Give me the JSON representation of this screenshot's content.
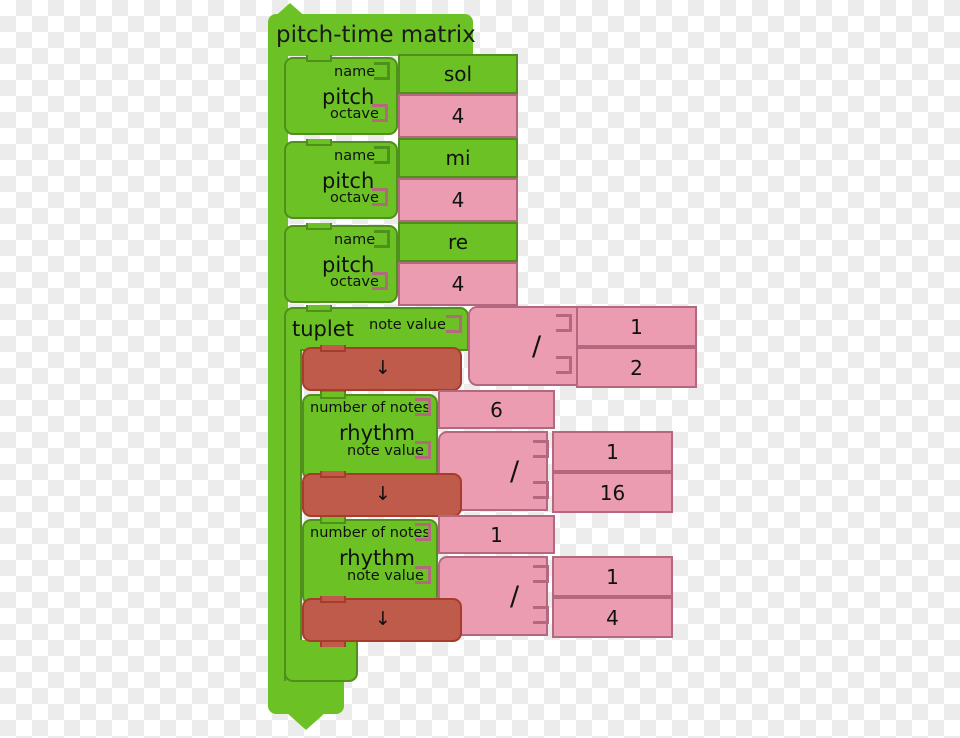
{
  "app": {
    "name": "music-blocks-visual-programming-canvas",
    "background": "transparent-checkerboard"
  },
  "palette": {
    "green": "#6cc124",
    "green_border": "#4f8f1c",
    "pink": "#eb9cb0",
    "pink_border": "#b4687f",
    "red": "#bf5b4b",
    "red_border": "#a63c29",
    "text": "#111111"
  },
  "matrix": {
    "title": "pitch-time matrix",
    "name": "pitch-time-matrix-block"
  },
  "pitch_blocks": [
    {
      "block_label": "pitch",
      "name_label": "name",
      "name_value": "sol",
      "octave_label": "octave",
      "octave_value": "4"
    },
    {
      "block_label": "pitch",
      "name_label": "name",
      "name_value": "mi",
      "octave_label": "octave",
      "octave_value": "4"
    },
    {
      "block_label": "pitch",
      "name_label": "name",
      "name_value": "re",
      "octave_label": "octave",
      "octave_value": "4"
    }
  ],
  "tuplet": {
    "label": "tuplet",
    "note_value_label": "note value",
    "note_value": {
      "operator": "/",
      "numerator": "1",
      "denominator": "2"
    },
    "note_glyph": "↓"
  },
  "rhythm_blocks": [
    {
      "label": "rhythm",
      "number_of_notes_label": "number of notes",
      "number_of_notes": "6",
      "note_value_label": "note value",
      "note_value": {
        "operator": "/",
        "numerator": "1",
        "denominator": "16"
      },
      "note_glyph": "↓"
    },
    {
      "label": "rhythm",
      "number_of_notes_label": "number of notes",
      "number_of_notes": "1",
      "note_value_label": "note value",
      "note_value": {
        "operator": "/",
        "numerator": "1",
        "denominator": "4"
      },
      "note_glyph": "↓"
    }
  ]
}
